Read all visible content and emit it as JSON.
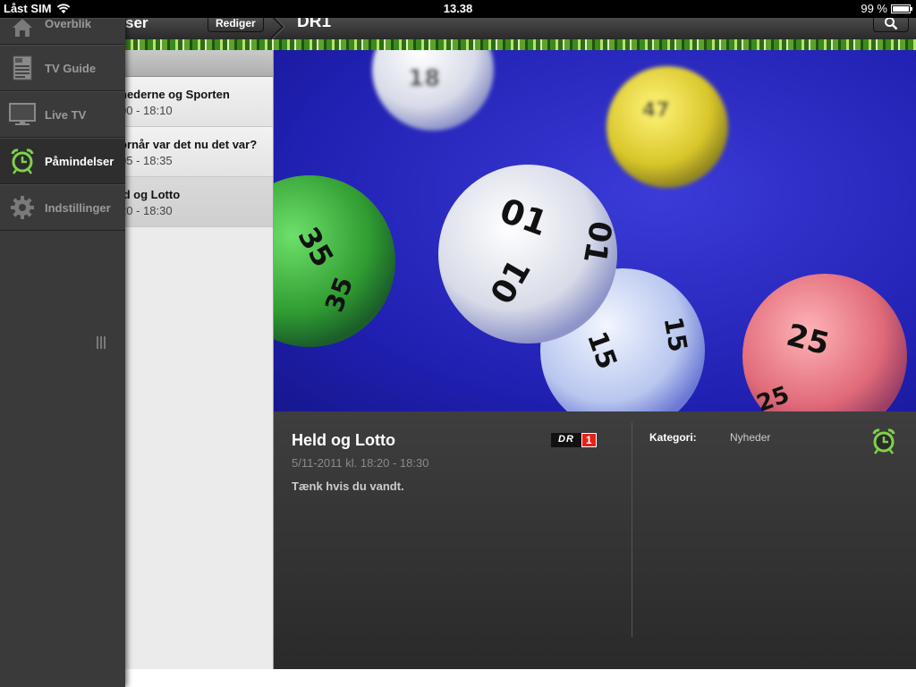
{
  "status": {
    "carrier": "Låst SIM",
    "time": "13.38",
    "battery": "99 %",
    "battery_level": 0.99
  },
  "nav": {
    "left_title": "ser",
    "edit_label": "Rediger",
    "right_title": "DR1"
  },
  "menu": {
    "items": [
      {
        "label": "Overblik",
        "icon": "home-icon"
      },
      {
        "label": "TV Guide",
        "icon": "tv-guide-icon"
      },
      {
        "label": "Live TV",
        "icon": "monitor-icon"
      },
      {
        "label": "Påmindelser",
        "icon": "alarm-clock-icon",
        "active": true
      },
      {
        "label": "Indstillinger",
        "icon": "gear-icon"
      }
    ]
  },
  "list": {
    "items": [
      {
        "title": "hederne og Sporten",
        "time": "00 - 18:10"
      },
      {
        "title": "ornår var det nu det var?",
        "time": "05 - 18:35"
      },
      {
        "title": "ld og Lotto",
        "time": "20 - 18:30",
        "selected": true
      }
    ]
  },
  "detail": {
    "title": "Held og Lotto",
    "date": "5/11-2011 kl. 18:20 - 18:30",
    "description": "Tænk hvis du vandt.",
    "channel_logo": {
      "text": "DR",
      "number": "1"
    },
    "category_label": "Kategori:",
    "category_value": "Nyheder"
  },
  "balls": [
    {
      "number": "01"
    },
    {
      "number": "25"
    },
    {
      "number": "35"
    },
    {
      "number": "15"
    },
    {
      "number": "47"
    },
    {
      "number": "18"
    }
  ]
}
